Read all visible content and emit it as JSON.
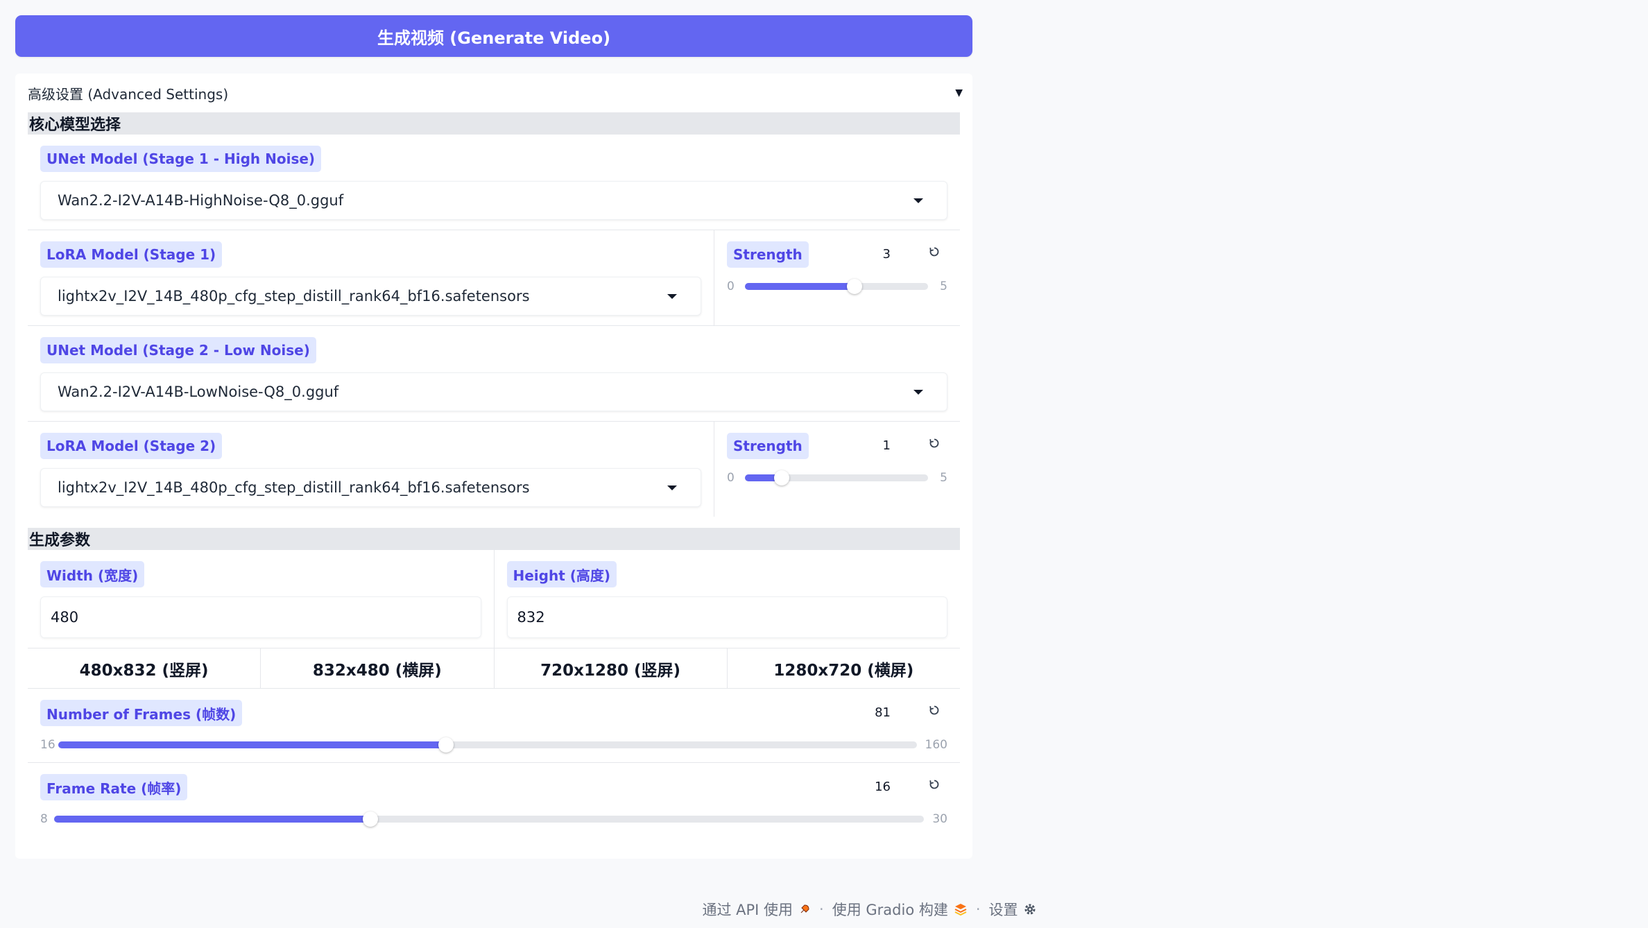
{
  "generate_button": {
    "label": "生成视频 (Generate Video)"
  },
  "accordion": {
    "title": "高级设置 (Advanced Settings)",
    "caret": "▼"
  },
  "sections": {
    "models_title": "核心模型选择",
    "params_title": "生成参数"
  },
  "unet1": {
    "label": "UNet Model (Stage 1 - High Noise)",
    "value": "Wan2.2-I2V-A14B-HighNoise-Q8_0.gguf"
  },
  "lora1": {
    "label": "LoRA Model (Stage 1)",
    "value": "lightx2v_I2V_14B_480p_cfg_step_distill_rank64_bf16.safetensors"
  },
  "strength1": {
    "label": "Strength",
    "value": "3",
    "min": "0",
    "max": "5",
    "fraction": 0.6
  },
  "unet2": {
    "label": "UNet Model (Stage 2 - Low Noise)",
    "value": "Wan2.2-I2V-A14B-LowNoise-Q8_0.gguf"
  },
  "lora2": {
    "label": "LoRA Model (Stage 2)",
    "value": "lightx2v_I2V_14B_480p_cfg_step_distill_rank64_bf16.safetensors"
  },
  "strength2": {
    "label": "Strength",
    "value": "1",
    "min": "0",
    "max": "5",
    "fraction": 0.2
  },
  "width": {
    "label": "Width (宽度)",
    "value": "480"
  },
  "height": {
    "label": "Height (高度)",
    "value": "832"
  },
  "presets": [
    "480x832 (竖屏)",
    "832x480 (横屏)",
    "720x1280 (竖屏)",
    "1280x720 (横屏)"
  ],
  "frames": {
    "label": "Number of Frames (帧数)",
    "value": "81",
    "min": "16",
    "max": "160",
    "fraction": 0.4514
  },
  "fps": {
    "label": "Frame Rate (帧率)",
    "value": "16",
    "min": "8",
    "max": "30",
    "fraction": 0.3636
  },
  "footer": {
    "api": "通过 API 使用",
    "built": "使用 Gradio 构建",
    "settings": "设置",
    "sep": "·"
  },
  "colors": {
    "accent": "#6366f1",
    "label_bg": "#e0e7ff",
    "label_text": "#4f46e5"
  }
}
